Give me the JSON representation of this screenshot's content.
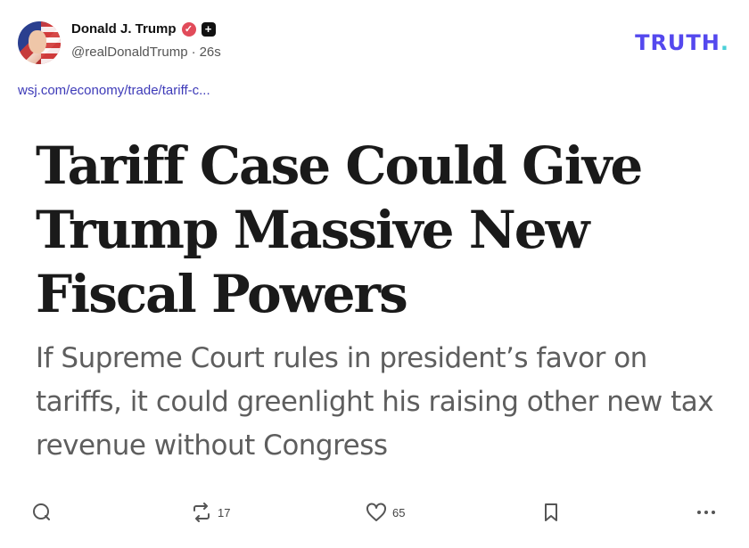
{
  "author": {
    "display_name": "Donald J. Trump",
    "handle": "@realDonaldTrump",
    "separator": "·",
    "time_ago": "26s",
    "verified_icon": "verified-badge-icon",
    "plus_icon": "plus-badge-icon"
  },
  "brand": {
    "logo_text": "TRUTH",
    "logo_dot": ".",
    "color": "#5448ee"
  },
  "post": {
    "link_text": "wsj.com/economy/trade/tariff-c...",
    "headline": "Tariff Case Could Give Trump Massive New Fiscal Powers",
    "dek": "If Supreme Court rules in president’s favor on tariffs, it could greenlight his raising other new tax revenue without Congress"
  },
  "actions": {
    "reply_icon": "reply-icon",
    "retruth_icon": "retruth-icon",
    "retruth_count": "17",
    "like_icon": "heart-icon",
    "like_count": "65",
    "bookmark_icon": "bookmark-icon",
    "more_icon": "more-icon"
  }
}
